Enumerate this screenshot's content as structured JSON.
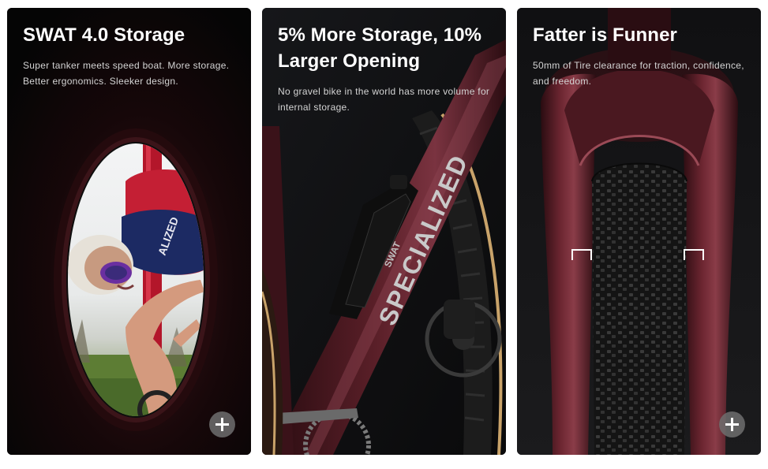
{
  "cards": [
    {
      "title": "SWAT 4.0 Storage",
      "description": "Super tanker meets speed boat. More storage. Better ergonomics. Sleeker design.",
      "expand_icon": "plus-icon"
    },
    {
      "title": "5% More Storage, 10% Larger Opening",
      "description": "No gravel bike in the world has more volume for internal storage.",
      "expand_icon": "plus-icon",
      "frame_text": "SPECIALIZED",
      "bag_text": "SWAT"
    },
    {
      "title": "Fatter is Funner",
      "description": "50mm of Tire clearance for traction, confidence, and freedom.",
      "expand_icon": "plus-icon"
    }
  ],
  "colors": {
    "card_background": "#0c0c0e",
    "title": "#ffffff",
    "description": "#d4d4d4",
    "frame_maroon": "#5a1f28",
    "tire_tan": "#c9a36a",
    "button_gray": "#6e6e6e"
  }
}
